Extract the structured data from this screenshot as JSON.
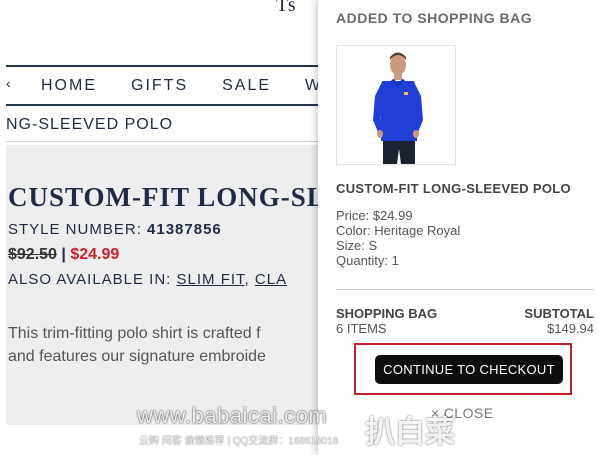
{
  "background": {
    "logo_fragment": "Ts",
    "nav": {
      "items": [
        "HOME",
        "GIFTS",
        "SALE",
        "W"
      ]
    },
    "breadcrumb": "NG-SLEEVED POLO",
    "product": {
      "title": "CUSTOM-FIT LONG-SL",
      "style_label": "STYLE NUMBER: ",
      "style_number": "41387856",
      "price_old": "$92.50",
      "price_separator": " | ",
      "price_new": "$24.99",
      "also_label": "ALSO AVAILABLE IN: ",
      "also_links": [
        "SLIM FIT",
        "CLA"
      ],
      "description_line1": "This trim-fitting polo shirt is crafted f",
      "description_line2": "and features our signature embroide"
    }
  },
  "panel": {
    "title": "ADDED TO SHOPPING BAG",
    "item_name": "CUSTOM-FIT LONG-SLEEVED POLO",
    "price": "Price: $24.99",
    "color": "Color: Heritage Royal",
    "size": "Size: S",
    "quantity": "Quantity: 1",
    "bag_label": "SHOPPING BAG",
    "bag_count": "6 ITEMS",
    "subtotal_label": "SUBTOTAL",
    "subtotal_value": "$149.94",
    "checkout_label": "CONTINUE TO CHECKOUT",
    "close_label": "CLOSE",
    "shirt_color": "#1f3fd6"
  },
  "watermark": {
    "url": "www.babaicai.com",
    "subtitle": "云购 闲客 偷懒推荐 | QQ交流群：168618018",
    "big_text": "扒白菜"
  }
}
